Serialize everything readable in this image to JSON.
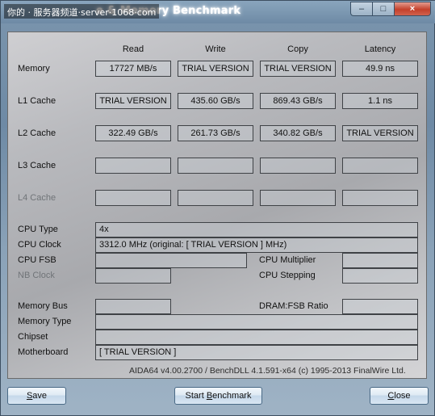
{
  "window": {
    "watermark": "你的 · 服务器频道·server·1068·com",
    "title": "e & Memory Benchmark",
    "controls": {
      "minimize": "–",
      "maximize": "□",
      "close": "×"
    }
  },
  "columns": [
    "Read",
    "Write",
    "Copy",
    "Latency"
  ],
  "rows": [
    {
      "label": "Memory",
      "dim": false,
      "values": [
        "17727 MB/s",
        "TRIAL VERSION",
        "TRIAL VERSION",
        "49.9 ns"
      ]
    },
    {
      "label": "L1 Cache",
      "dim": false,
      "values": [
        "TRIAL VERSION",
        "435.60 GB/s",
        "869.43 GB/s",
        "1.1 ns"
      ]
    },
    {
      "label": "L2 Cache",
      "dim": false,
      "values": [
        "322.49 GB/s",
        "261.73 GB/s",
        "340.82 GB/s",
        "TRIAL VERSION"
      ]
    },
    {
      "label": "L3 Cache",
      "dim": false,
      "values": [
        "",
        "",
        "",
        ""
      ]
    },
    {
      "label": "L4 Cache",
      "dim": true,
      "values": [
        "",
        "",
        "",
        ""
      ]
    }
  ],
  "cpu": {
    "type_label": "CPU Type",
    "type_value": "4x",
    "clock_label": "CPU Clock",
    "clock_value": "3312.0 MHz  (original: [ TRIAL VERSION ] MHz)",
    "fsb_label": "CPU FSB",
    "fsb_value": "",
    "multiplier_label": "CPU Multiplier",
    "multiplier_value": "",
    "nbclock_label": "NB Clock",
    "nbclock_value": "",
    "stepping_label": "CPU Stepping",
    "stepping_value": ""
  },
  "memory_info": {
    "bus_label": "Memory Bus",
    "bus_value": "",
    "ratio_label": "DRAM:FSB Ratio",
    "ratio_value": "",
    "type_label": "Memory Type",
    "type_value": "",
    "chipset_label": "Chipset",
    "chipset_value": "",
    "motherboard_label": "Motherboard",
    "motherboard_value": "[ TRIAL VERSION ]"
  },
  "footer": {
    "copyright": "AIDA64 v4.00.2700 / BenchDLL 4.1.591-x64  (c) 1995-2013 FinalWire Ltd.",
    "save_prefix": "",
    "save_key": "S",
    "save_rest": "ave",
    "start_prefix": "Start ",
    "start_key": "B",
    "start_rest": "enchmark",
    "close_prefix": "",
    "close_key": "C",
    "close_rest": "lose"
  }
}
